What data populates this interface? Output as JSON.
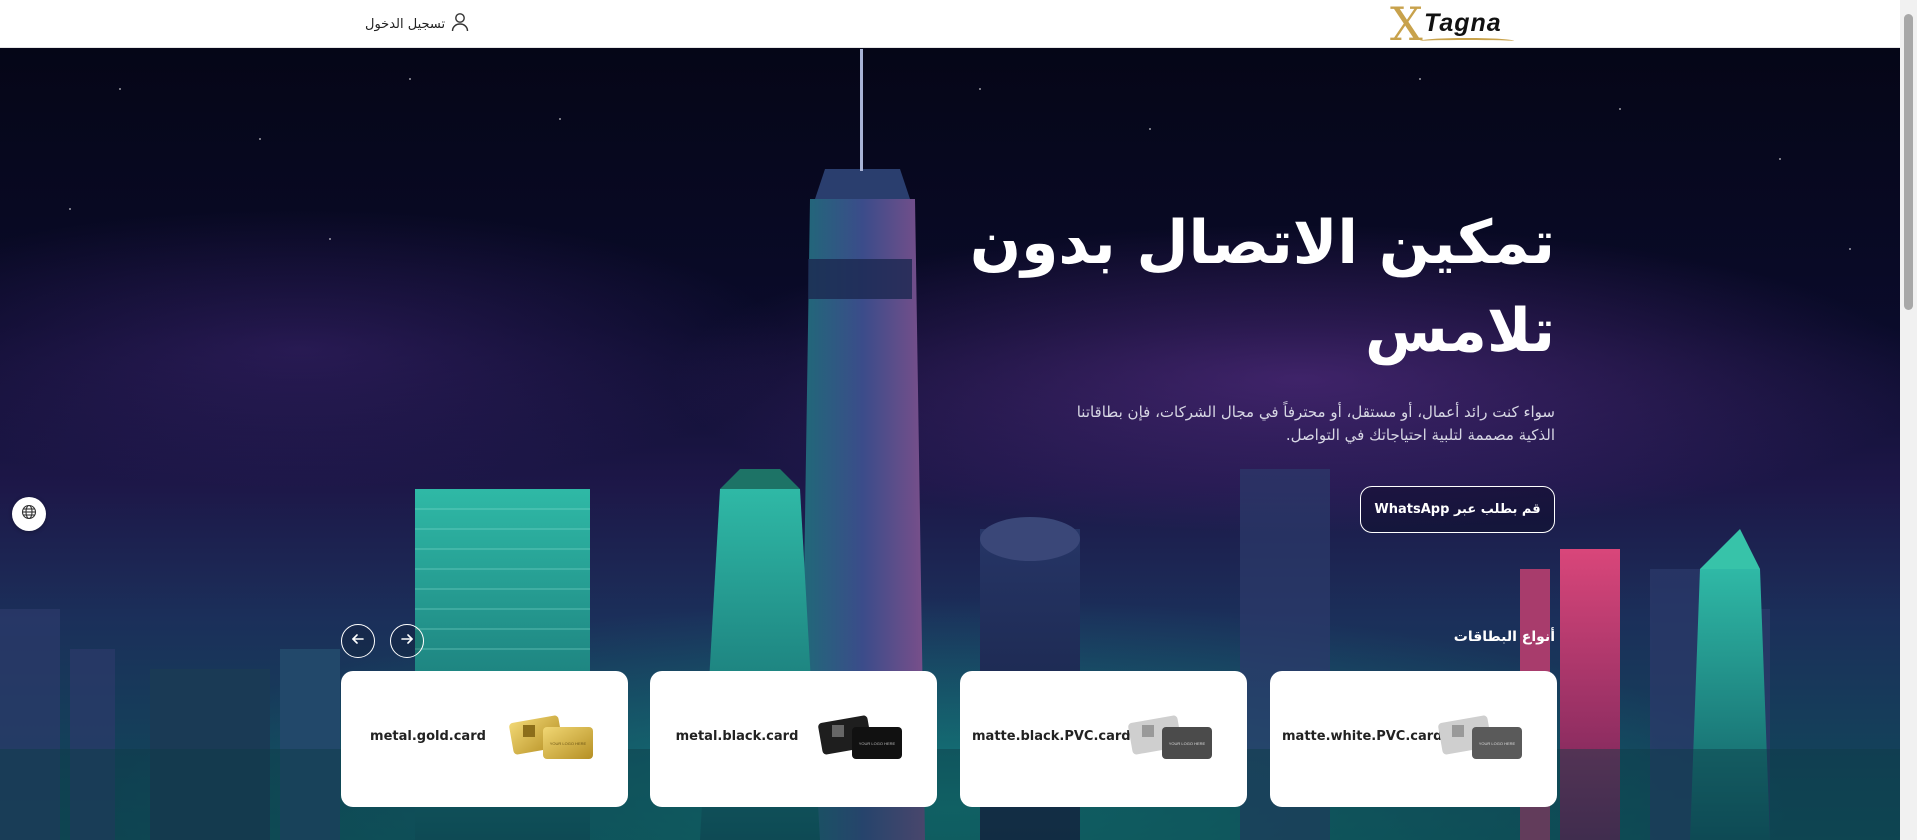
{
  "header": {
    "logo_text": "Tagna",
    "logo_x": "X",
    "login_label": "تسجيل الدخول"
  },
  "hero": {
    "title": "تمكين الاتصال بدون تلامس",
    "subtitle": "سواء كنت رائد أعمال، أو مستقل، أو محترفاً في مجال الشركات، فإن بطاقاتنا الذكية مصممة لتلبية احتياجاتك في التواصل.",
    "cta_label": "قم بطلب عبر WhatsApp"
  },
  "cards_section": {
    "label": "أنواع البطاقات",
    "cards": [
      {
        "name": "matte.white.PVC.card",
        "finish": "matte-white"
      },
      {
        "name": "matte.black.PVC.card",
        "finish": "matte-black"
      },
      {
        "name": "metal.black.card",
        "finish": "metal-black"
      },
      {
        "name": "metal.gold.card",
        "finish": "metal-gold"
      }
    ],
    "card_print_text": "YOUR LOGO HERE"
  },
  "icons": {
    "login": "user-icon",
    "language": "globe-icon",
    "prev": "arrow-left-icon",
    "next": "arrow-right-icon"
  },
  "colors": {
    "brand_gold": "#c8a24c",
    "hero_bg": "#05061a",
    "card_bg": "#ffffff"
  }
}
